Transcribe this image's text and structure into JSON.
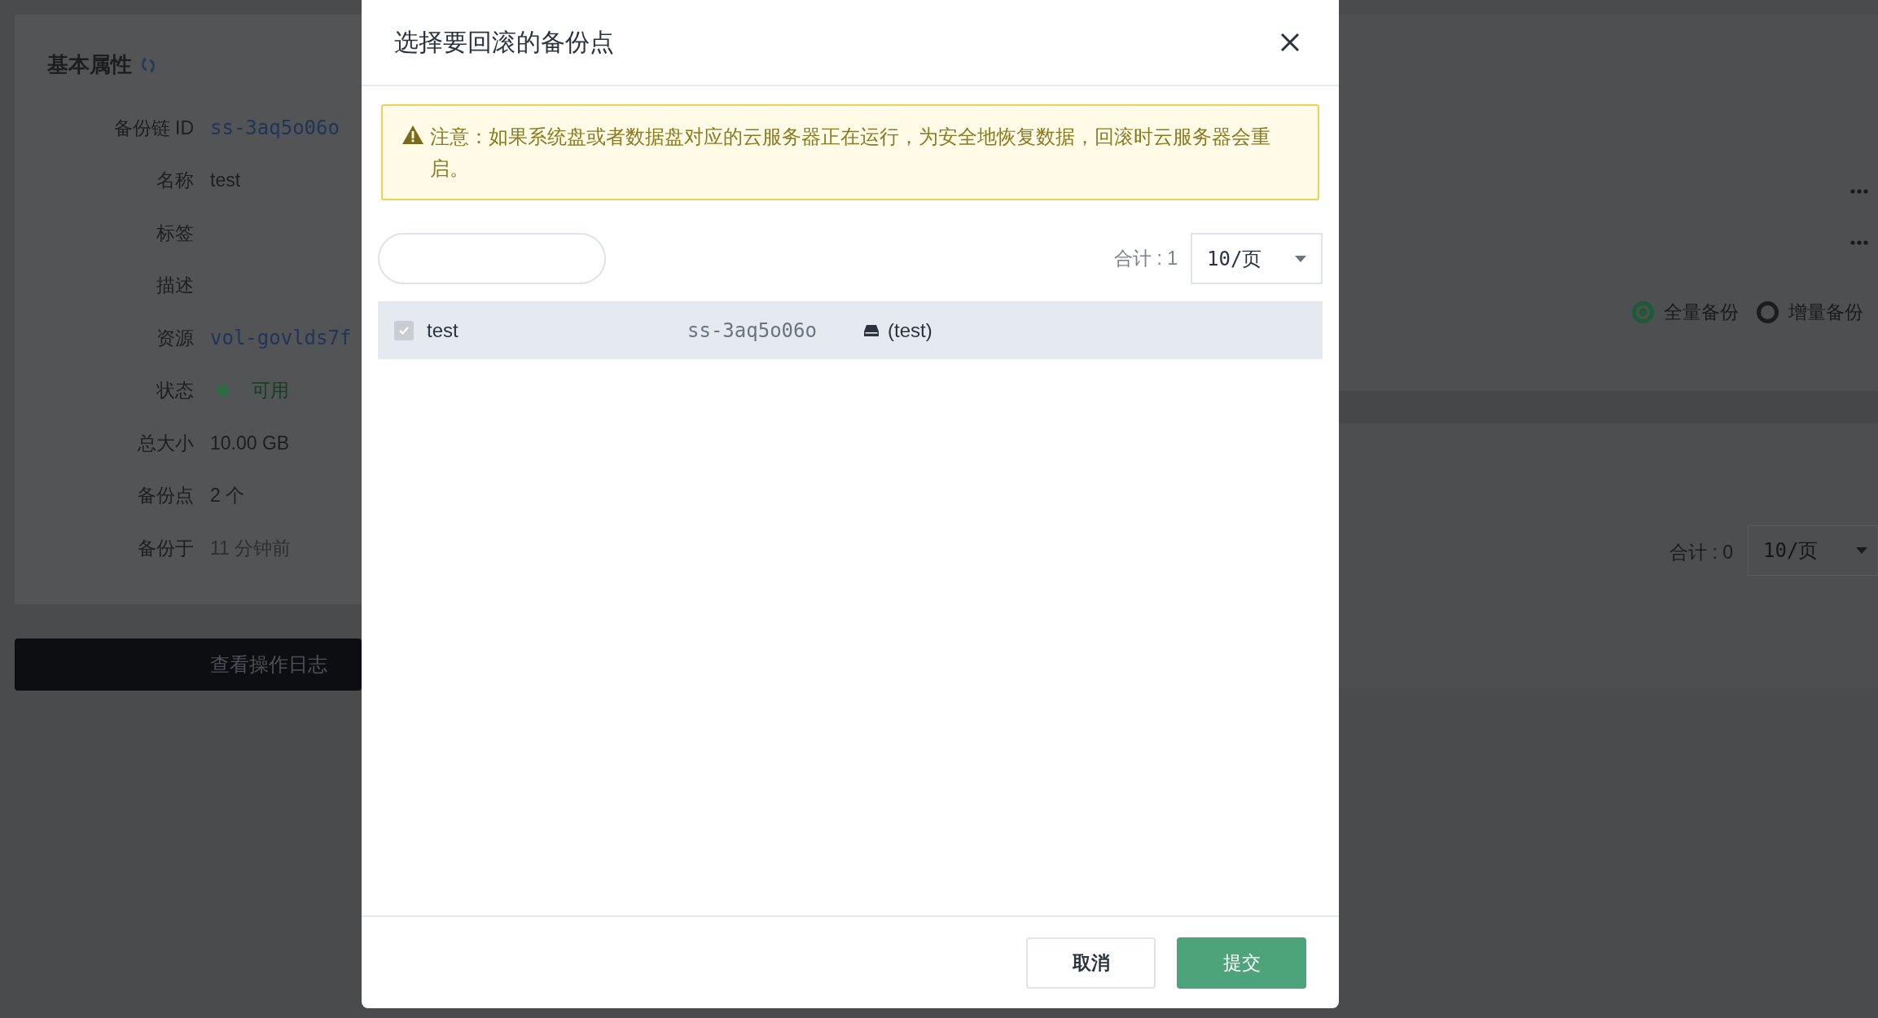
{
  "page": {
    "properties": {
      "title": "基本属性",
      "rows": [
        {
          "label": "备份链 ID",
          "value": "ss-3aq5o06o",
          "kind": "link"
        },
        {
          "label": "名称",
          "value": "test",
          "kind": "text"
        },
        {
          "label": "标签",
          "kind": "empty"
        },
        {
          "label": "描述",
          "kind": "empty"
        },
        {
          "label": "资源",
          "value": "vol-govlds7f",
          "kind": "link"
        },
        {
          "label": "状态",
          "value": "可用",
          "kind": "status",
          "color": "#2e6b45"
        },
        {
          "label": "总大小",
          "value": "10.00 GB",
          "kind": "text"
        },
        {
          "label": "备份点",
          "value": "2 个",
          "kind": "text"
        },
        {
          "label": "备份于",
          "value": "11 分钟前",
          "kind": "muted"
        }
      ]
    },
    "log_button": "查看操作日志",
    "backup_types": [
      {
        "label": "全量备份",
        "selected": true
      },
      {
        "label": "增量备份",
        "selected": false
      }
    ],
    "pagination": {
      "total": "合计 : 0",
      "page_size": "10/页"
    }
  },
  "dialog": {
    "title": "选择要回滚的备份点",
    "notice": "注意：如果系统盘或者数据盘对应的云服务器正在运行，为安全地恢复数据，回滚时云服务器会重启。",
    "total": "合计 : 1",
    "page_size": "10/页",
    "rows": [
      {
        "name": "test",
        "id": "ss-3aq5o06o",
        "disk": "(test)",
        "checked": true,
        "selected": true
      }
    ],
    "buttons": [
      {
        "label": "取消",
        "kind": "secondary"
      },
      {
        "label": "提交",
        "kind": "primary"
      }
    ]
  }
}
